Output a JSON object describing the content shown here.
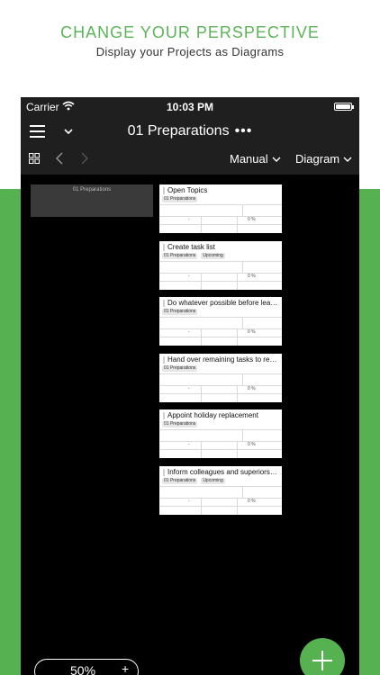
{
  "promo": {
    "headline": "CHANGE YOUR PERSPECTIVE",
    "subline": "Display your Projects as Diagrams"
  },
  "statusbar": {
    "carrier": "Carrier",
    "time": "10:03 PM"
  },
  "navbar": {
    "title": "01 Preparations",
    "more": "•••",
    "sort_mode": "Manual",
    "view_mode": "Diagram"
  },
  "diagram": {
    "group_label": "01 Preparations",
    "cards": [
      {
        "title": "Open Topics",
        "tags": [
          "01 Preparations"
        ],
        "dash": "-",
        "percent": "0 %"
      },
      {
        "title": "Create task list",
        "tags": [
          "01 Preparations",
          "Upcoming"
        ],
        "dash": "-",
        "percent": "0 %"
      },
      {
        "title": "Do whatever possible before lea…",
        "tags": [
          "01 Preparations"
        ],
        "dash": "-",
        "percent": "0 %"
      },
      {
        "title": "Hand over remaining tasks to re…",
        "tags": [
          "01 Preparations"
        ],
        "dash": "-",
        "percent": "0 %"
      },
      {
        "title": "Appoint holiday replacement",
        "tags": [
          "01 Preparations"
        ],
        "dash": "-",
        "percent": "0 %"
      },
      {
        "title": "Inform colleagues and superiors …",
        "tags": [
          "01 Preparations",
          "Upcoming"
        ],
        "dash": "-",
        "percent": "0 %"
      }
    ]
  },
  "zoom": {
    "value": "50%",
    "plus": "+"
  },
  "colors": {
    "accent_green": "#56b151",
    "bar_dark": "#1f1f1f"
  }
}
